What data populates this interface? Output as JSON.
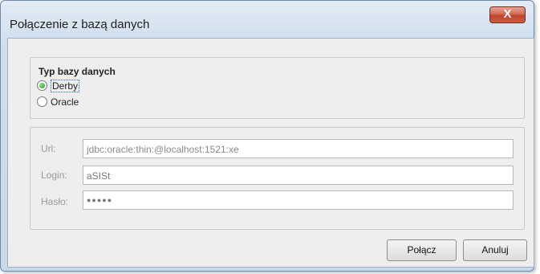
{
  "window": {
    "title": "Połączenie z bazą danych",
    "close_label": "X"
  },
  "db_type": {
    "title": "Typ bazy danych",
    "options": [
      {
        "label": "Derby",
        "selected": true
      },
      {
        "label": "Oracle",
        "selected": false
      }
    ]
  },
  "connection": {
    "url_label": "Url:",
    "url_value": "jdbc:oracle:thin:@localhost:1521:xe",
    "login_label": "Login:",
    "login_value": "aSISt",
    "password_label": "Hasło:",
    "password_value": "●●●●●"
  },
  "buttons": {
    "connect": "Połącz",
    "cancel": "Anuluj"
  },
  "colors": {
    "close_button": "#c0432b",
    "radio_selected": "#2e9a2e"
  }
}
